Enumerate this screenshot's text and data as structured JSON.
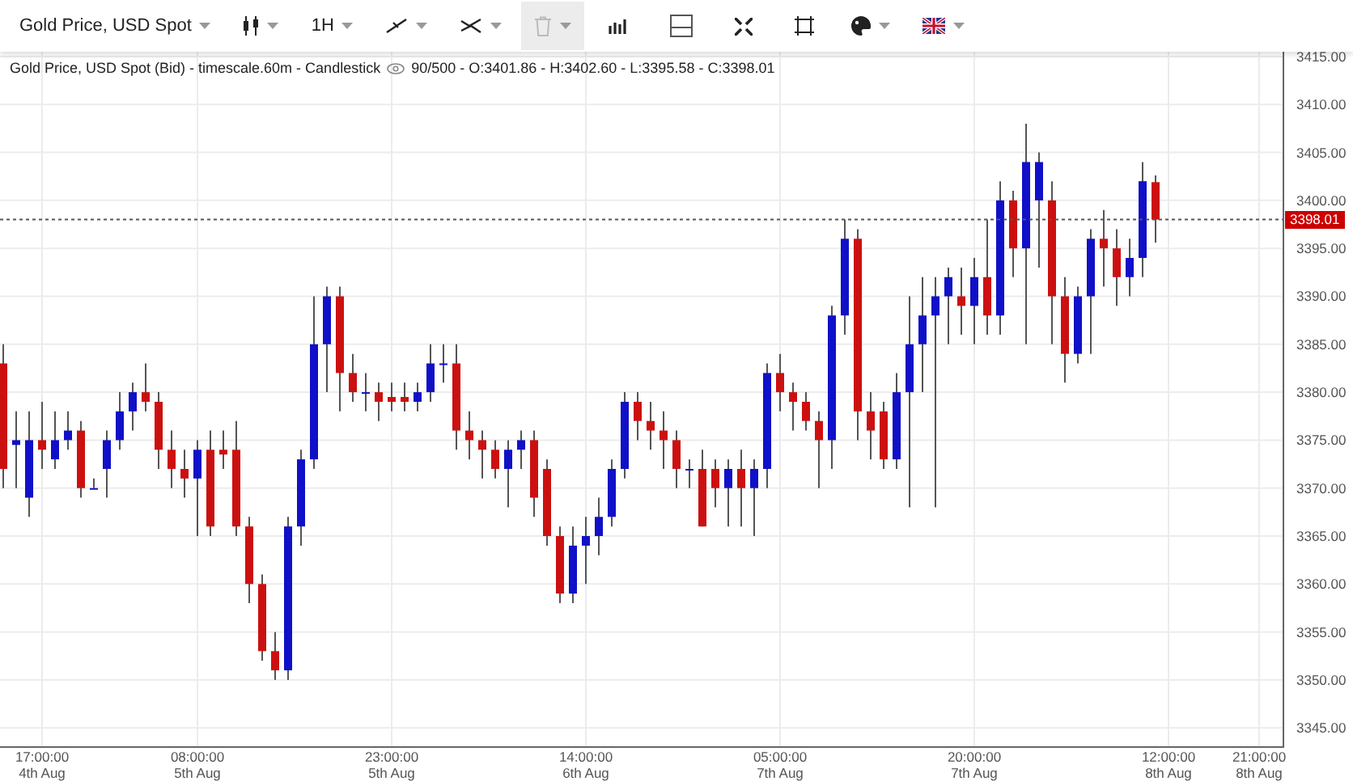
{
  "toolbar": [
    {
      "kind": "menu",
      "label": "Gold Price, USD Spot",
      "disabled": false
    },
    {
      "kind": "icon-menu",
      "disabled": false
    },
    {
      "kind": "menu",
      "label": "1H",
      "disabled": false
    },
    {
      "kind": "icon-menu",
      "disabled": false
    },
    {
      "kind": "icon-menu",
      "disabled": false
    },
    {
      "kind": "icon-menu",
      "disabled": true
    },
    {
      "kind": "icon",
      "disabled": false
    },
    {
      "kind": "icon",
      "disabled": false
    },
    {
      "kind": "icon",
      "disabled": false
    },
    {
      "kind": "icon",
      "disabled": false
    },
    {
      "kind": "icon-menu",
      "disabled": false
    },
    {
      "kind": "icon-menu",
      "disabled": false
    }
  ],
  "chart": {
    "caption": "Gold Price, USD Spot (Bid) - timescale.60m - Candlestick",
    "quote": "90/500 - O:3401.86 - H:3402.60 - L:3395.58 - C:3398.01",
    "chart_data": {
      "type": "candlestick",
      "grid": true,
      "ylim": [
        3343.0,
        3415.5
      ],
      "yticks": [
        {
          "value": 3345,
          "label": "3345.00"
        },
        {
          "value": 3350,
          "label": "3350.00"
        },
        {
          "value": 3355,
          "label": "3355.00"
        },
        {
          "value": 3360,
          "label": "3360.00"
        },
        {
          "value": 3365,
          "label": "3365.00"
        },
        {
          "value": 3370,
          "label": "3370.00"
        },
        {
          "value": 3375,
          "label": "3375.00"
        },
        {
          "value": 3380,
          "label": "3380.00"
        },
        {
          "value": 3385,
          "label": "3385.00"
        },
        {
          "value": 3390,
          "label": "3390.00"
        },
        {
          "value": 3395,
          "label": "3395.00"
        },
        {
          "value": 3400,
          "label": "3400.00"
        },
        {
          "value": 3405,
          "label": "3405.00"
        },
        {
          "value": 3410,
          "label": "3410.00"
        },
        {
          "value": 3415,
          "label": "3415.00"
        }
      ],
      "categories": [
        null,
        null,
        null,
        "17:00:00 4th Aug",
        null,
        null,
        null,
        null,
        null,
        null,
        null,
        null,
        null,
        null,
        null,
        "08:00:00 5th Aug",
        null,
        null,
        null,
        null,
        null,
        null,
        null,
        null,
        null,
        null,
        null,
        null,
        null,
        null,
        "23:00:00 5th Aug",
        null,
        null,
        null,
        null,
        null,
        null,
        null,
        null,
        null,
        null,
        null,
        null,
        null,
        null,
        "14:00:00 6th Aug",
        null,
        null,
        null,
        null,
        null,
        null,
        null,
        null,
        null,
        null,
        null,
        null,
        null,
        null,
        "05:00:00 7th Aug",
        null,
        null,
        null,
        null,
        null,
        null,
        null,
        null,
        null,
        null,
        null,
        null,
        null,
        null,
        "20:00:00 7th Aug",
        null,
        null,
        null,
        null,
        null,
        null,
        null,
        null,
        null,
        null,
        null,
        null,
        null,
        null,
        "12:00:00 8th Aug",
        null,
        null,
        null,
        null,
        null,
        null,
        "21:00:00 8th Aug"
      ],
      "ohlc": [
        [
          3383,
          3385,
          3370,
          3372
        ],
        [
          3374.5,
          3378,
          3370,
          3375
        ],
        [
          3369,
          3378,
          3367,
          3375
        ],
        [
          3375,
          3379,
          3372,
          3374
        ],
        [
          3373,
          3378,
          3372,
          3375
        ],
        [
          3375,
          3378,
          3374,
          3376
        ],
        [
          3376,
          3377,
          3369,
          3370
        ],
        [
          3370,
          3371,
          3370,
          3370
        ],
        [
          3372,
          3376,
          3369,
          3375
        ],
        [
          3375,
          3380,
          3374,
          3378
        ],
        [
          3378,
          3381,
          3376,
          3380
        ],
        [
          3380,
          3383,
          3378,
          3379
        ],
        [
          3379,
          3380,
          3372,
          3374
        ],
        [
          3374,
          3376,
          3370,
          3372
        ],
        [
          3372,
          3374,
          3369,
          3371
        ],
        [
          3371,
          3375,
          3365,
          3374
        ],
        [
          3374,
          3376,
          3365,
          3366
        ],
        [
          3374,
          3376,
          3372,
          3373.5
        ],
        [
          3374,
          3377,
          3365,
          3366
        ],
        [
          3366,
          3367,
          3358,
          3360
        ],
        [
          3360,
          3361,
          3352,
          3353
        ],
        [
          3353,
          3355,
          3350,
          3351
        ],
        [
          3351,
          3367,
          3350,
          3366
        ],
        [
          3366,
          3374,
          3364,
          3373
        ],
        [
          3373,
          3390,
          3372,
          3385
        ],
        [
          3385,
          3391,
          3380,
          3390
        ],
        [
          3390,
          3391,
          3378,
          3382
        ],
        [
          3382,
          3384,
          3379,
          3380
        ],
        [
          3380,
          3382,
          3378,
          3380
        ],
        [
          3380,
          3381,
          3377,
          3379
        ],
        [
          3379.5,
          3381,
          3378,
          3379
        ],
        [
          3379.5,
          3381,
          3378,
          3379
        ],
        [
          3379,
          3381,
          3378,
          3380
        ],
        [
          3380,
          3385,
          3379,
          3383
        ],
        [
          3383,
          3385,
          3381,
          3383
        ],
        [
          3383,
          3385,
          3374,
          3376
        ],
        [
          3376,
          3378,
          3373,
          3375
        ],
        [
          3375,
          3376,
          3371,
          3374
        ],
        [
          3374,
          3375,
          3371,
          3372
        ],
        [
          3372,
          3375,
          3368,
          3374
        ],
        [
          3374,
          3376,
          3372,
          3375
        ],
        [
          3375,
          3376,
          3367,
          3369
        ],
        [
          3372,
          3373,
          3364,
          3365
        ],
        [
          3365,
          3366,
          3358,
          3359
        ],
        [
          3359,
          3366,
          3358,
          3364
        ],
        [
          3364,
          3367,
          3360,
          3365
        ],
        [
          3365,
          3369,
          3363,
          3367
        ],
        [
          3367,
          3373,
          3366,
          3372
        ],
        [
          3372,
          3380,
          3371,
          3379
        ],
        [
          3379,
          3380,
          3375,
          3377
        ],
        [
          3377,
          3379,
          3374,
          3376
        ],
        [
          3376,
          3378,
          3372,
          3375
        ],
        [
          3375,
          3376,
          3370,
          3372
        ],
        [
          3372,
          3373,
          3370,
          3372
        ],
        [
          3372,
          3374,
          3366,
          3366
        ],
        [
          3372,
          3373,
          3368,
          3370
        ],
        [
          3370,
          3373,
          3366,
          3372
        ],
        [
          3372,
          3374,
          3366,
          3370
        ],
        [
          3370,
          3373,
          3365,
          3372
        ],
        [
          3372,
          3383,
          3370,
          3382
        ],
        [
          3382,
          3384,
          3378,
          3380
        ],
        [
          3380,
          3381,
          3376,
          3379
        ],
        [
          3379,
          3380,
          3376,
          3377
        ],
        [
          3377,
          3378,
          3370,
          3375
        ],
        [
          3375,
          3389,
          3372,
          3388
        ],
        [
          3388,
          3398,
          3386,
          3396
        ],
        [
          3396,
          3397,
          3375,
          3378
        ],
        [
          3378,
          3380,
          3373,
          3376
        ],
        [
          3378,
          3379,
          3372,
          3373
        ],
        [
          3373,
          3382,
          3372,
          3380
        ],
        [
          3380,
          3390,
          3368,
          3385
        ],
        [
          3385,
          3392,
          3380,
          3388
        ],
        [
          3388,
          3392,
          3368,
          3390
        ],
        [
          3390,
          3393,
          3385,
          3392
        ],
        [
          3390,
          3393,
          3386,
          3389
        ],
        [
          3389,
          3394,
          3385,
          3392
        ],
        [
          3392,
          3398,
          3386,
          3388
        ],
        [
          3388,
          3402,
          3386,
          3400
        ],
        [
          3400,
          3401,
          3392,
          3395
        ],
        [
          3395,
          3408,
          3385,
          3404
        ],
        [
          3400,
          3405,
          3393,
          3404
        ],
        [
          3400,
          3402,
          3385,
          3390
        ],
        [
          3390,
          3392,
          3381,
          3384
        ],
        [
          3384,
          3391,
          3383,
          3390
        ],
        [
          3390,
          3397,
          3384,
          3396
        ],
        [
          3396,
          3399,
          3391,
          3395
        ],
        [
          3395,
          3397,
          3389,
          3392
        ],
        [
          3392,
          3396,
          3390,
          3394
        ],
        [
          3394,
          3404,
          3392,
          3402
        ],
        [
          3401.9,
          3402.6,
          3395.6,
          3398
        ],
        null,
        null,
        null,
        null,
        null,
        null,
        null,
        null
      ],
      "ref_lines": [
        {
          "axis": "y",
          "value": 3398.01,
          "label": "3398.01"
        }
      ]
    }
  }
}
